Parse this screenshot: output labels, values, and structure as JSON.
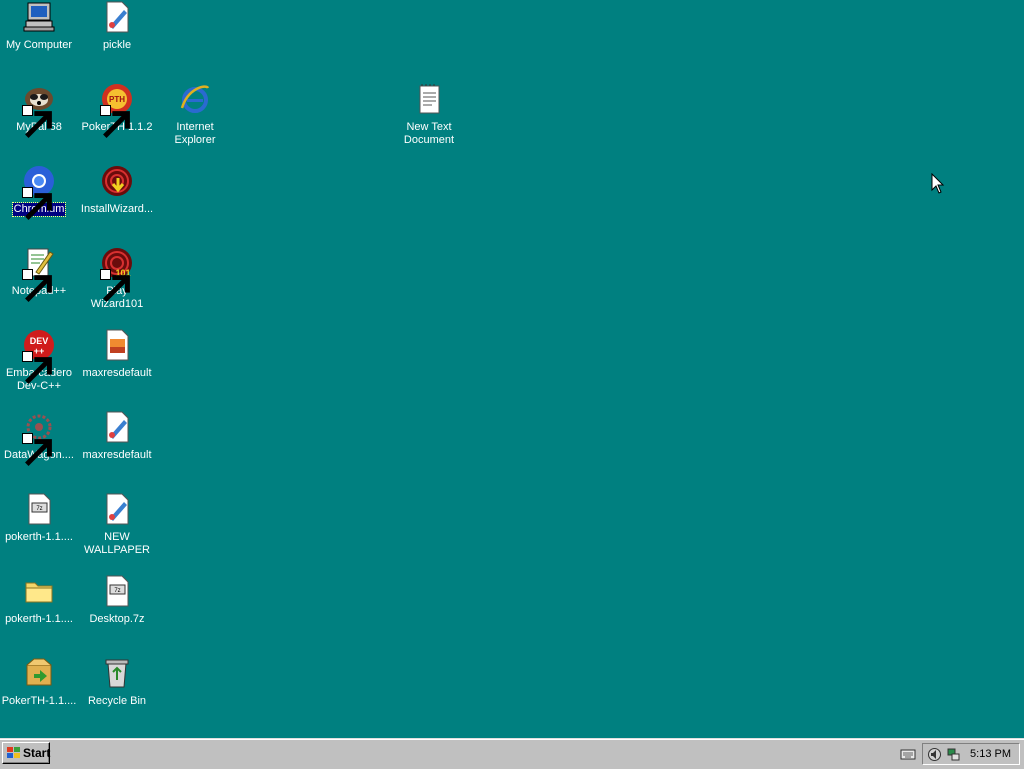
{
  "desktop": {
    "background": "#008080",
    "icons": [
      {
        "label": "My Computer",
        "icon": "my-computer-icon",
        "shortcut": false
      },
      {
        "label": "pickle",
        "icon": "paint-image-file-icon",
        "shortcut": false
      },
      {
        "label": "MyPal 68",
        "icon": "mypal-icon",
        "shortcut": true
      },
      {
        "label": "PokerTH 1.1.2",
        "icon": "pokerth-icon",
        "shortcut": true
      },
      {
        "label": "Internet Explorer",
        "icon": "internet-explorer-icon",
        "shortcut": false
      },
      {
        "label": "New Text Document",
        "icon": "text-document-icon",
        "shortcut": false
      },
      {
        "label": "Chromium",
        "icon": "chromium-icon",
        "shortcut": true,
        "selected": true
      },
      {
        "label": "InstallWizard...",
        "icon": "install-wizard-icon",
        "shortcut": false
      },
      {
        "label": "Notepad++",
        "icon": "notepadplusplus-icon",
        "shortcut": true
      },
      {
        "label": "Play Wizard101",
        "icon": "wizard101-icon",
        "shortcut": true
      },
      {
        "label": "Embarcadero Dev-C++",
        "icon": "devcpp-icon",
        "shortcut": true
      },
      {
        "label": "maxresdefault",
        "icon": "image-file-icon",
        "shortcut": false
      },
      {
        "label": "DataWagon....",
        "icon": "datawagon-icon",
        "shortcut": true
      },
      {
        "label": "maxresdefault",
        "icon": "paint-image-file-icon",
        "shortcut": false
      },
      {
        "label": "pokerth-1.1....",
        "icon": "archive-file-icon",
        "shortcut": false
      },
      {
        "label": "NEW WALLPAPER",
        "icon": "paint-image-file-icon",
        "shortcut": false
      },
      {
        "label": "pokerth-1.1....",
        "icon": "folder-icon",
        "shortcut": false
      },
      {
        "label": "Desktop.7z",
        "icon": "archive-file-icon",
        "shortcut": false
      },
      {
        "label": "PokerTH-1.1....",
        "icon": "installer-package-icon",
        "shortcut": false
      },
      {
        "label": "Recycle Bin",
        "icon": "recycle-bin-icon",
        "shortcut": false
      }
    ]
  },
  "taskbar": {
    "start_label": "Start",
    "clock": "5:13 PM",
    "tray_icons": [
      "keyboard-icon",
      "volume-icon",
      "network-icon"
    ]
  }
}
